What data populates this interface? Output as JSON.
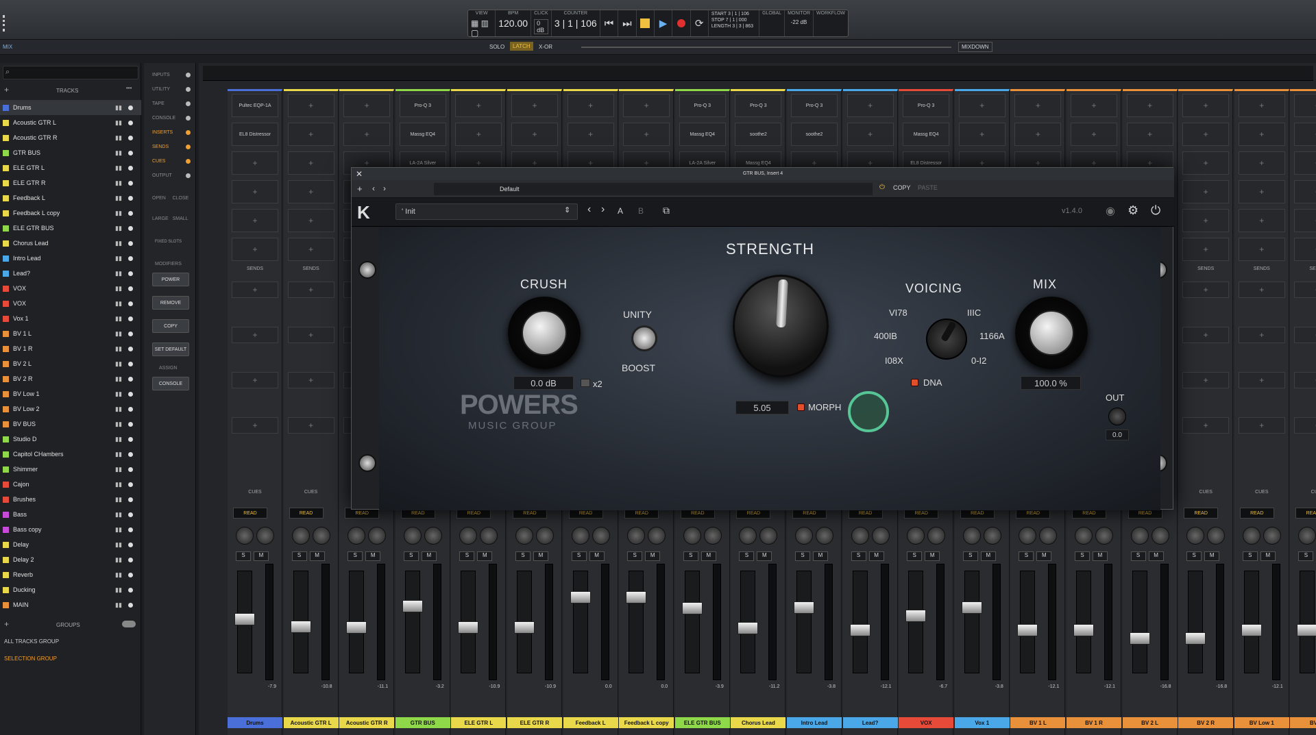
{
  "transport": {
    "view_label": "VIEW",
    "bpm_label": "BPM",
    "bpm": "120.00",
    "click_label": "CLICK",
    "click_db": "0 dB",
    "counter_label": "COUNTER",
    "counter": "3 | 1 | 106",
    "start_label": "START",
    "stop_label": "STOP",
    "length_label": "LENGTH",
    "start_val": "3 | 1 | 106",
    "stop_val": "7 | 1 | 000",
    "length_val": "3 | 3 | 863",
    "global_label": "GLOBAL",
    "monitor_label": "MONITOR",
    "monitor_db": "-22 dB",
    "workflow_label": "WORKFLOW"
  },
  "subbar": {
    "mix_label": "MIX",
    "solo": "SOLO",
    "latch": "LATCH",
    "xor": "X-OR",
    "mixdown": "MIXDOWN"
  },
  "tracks_header": "TRACKS",
  "tracks": [
    {
      "name": "Drums",
      "color": "#4a6fd8"
    },
    {
      "name": "Acoustic GTR L",
      "color": "#e8d84a"
    },
    {
      "name": "Acoustic GTR R",
      "color": "#e8d84a"
    },
    {
      "name": "GTR BUS",
      "color": "#8fd84a"
    },
    {
      "name": "ELE GTR L",
      "color": "#e8d84a"
    },
    {
      "name": "ELE GTR R",
      "color": "#e8d84a"
    },
    {
      "name": "Feedback L",
      "color": "#e8d84a"
    },
    {
      "name": "Feedback L copy",
      "color": "#e8d84a"
    },
    {
      "name": "ELE GTR BUS",
      "color": "#8fd84a"
    },
    {
      "name": "Chorus Lead",
      "color": "#e8d84a"
    },
    {
      "name": "Intro Lead",
      "color": "#4aa8e8"
    },
    {
      "name": "Lead?",
      "color": "#4aa8e8"
    },
    {
      "name": "VOX",
      "color": "#e84a3a"
    },
    {
      "name": "VOX",
      "color": "#e84a3a"
    },
    {
      "name": "Vox 1",
      "color": "#e84a3a"
    },
    {
      "name": "BV 1 L",
      "color": "#e8903a"
    },
    {
      "name": "BV 1 R",
      "color": "#e8903a"
    },
    {
      "name": "BV 2 L",
      "color": "#e8903a"
    },
    {
      "name": "BV 2 R",
      "color": "#e8903a"
    },
    {
      "name": "BV Low 1",
      "color": "#e8903a"
    },
    {
      "name": "BV Low 2",
      "color": "#e8903a"
    },
    {
      "name": "BV BUS",
      "color": "#e8903a"
    },
    {
      "name": "Studio D",
      "color": "#8fd84a"
    },
    {
      "name": "Capitol CHambers",
      "color": "#8fd84a"
    },
    {
      "name": "Shimmer",
      "color": "#8fd84a"
    },
    {
      "name": "Cajon",
      "color": "#e84a3a"
    },
    {
      "name": "Brushes",
      "color": "#e84a3a"
    },
    {
      "name": "Bass",
      "color": "#c84ad8"
    },
    {
      "name": "Bass copy",
      "color": "#c84ad8"
    },
    {
      "name": "Delay",
      "color": "#e8d84a"
    },
    {
      "name": "Delay 2",
      "color": "#e8d84a"
    },
    {
      "name": "Reverb",
      "color": "#e8d84a"
    },
    {
      "name": "Ducking",
      "color": "#e8d84a"
    },
    {
      "name": "MAIN",
      "color": "#e8903a"
    }
  ],
  "groups": {
    "header": "GROUPS",
    "all": "ALL TRACKS GROUP",
    "selection": "SELECTION GROUP"
  },
  "midcol": {
    "items": [
      "INPUTS",
      "UTILITY",
      "TAPE",
      "CONSOLE",
      "INSERTS",
      "SENDS",
      "CUES",
      "OUTPUT"
    ],
    "open": "OPEN",
    "close": "CLOSE",
    "large": "LARGE",
    "small": "SMALL",
    "fixed": "FIXED SLOTS",
    "modifiers": "MODIFIERS",
    "power": "POWER",
    "remove": "REMOVE",
    "copy": "COPY",
    "set_default": "SET DEFAULT",
    "assign": "ASSIGN",
    "console": "CONSOLE"
  },
  "strips": [
    {
      "name": "Drums",
      "color": "#4a6fd8",
      "vol": "-7.9",
      "inserts": [
        "Pultec EQP-1A",
        "EL8 Distressor"
      ]
    },
    {
      "name": "Acoustic GTR L",
      "color": "#e8d84a",
      "vol": "-10.8",
      "inserts": []
    },
    {
      "name": "Acoustic GTR R",
      "color": "#e8d84a",
      "vol": "-11.1",
      "inserts": []
    },
    {
      "name": "GTR BUS",
      "color": "#8fd84a",
      "vol": "-3.2",
      "inserts": [
        "Pro-Q 3",
        "Massg EQ4",
        "LA-2A Silver"
      ]
    },
    {
      "name": "ELE GTR L",
      "color": "#e8d84a",
      "vol": "-10.9",
      "inserts": []
    },
    {
      "name": "ELE GTR R",
      "color": "#e8d84a",
      "vol": "-10.9",
      "inserts": []
    },
    {
      "name": "Feedback L",
      "color": "#e8d84a",
      "vol": "0.0",
      "inserts": []
    },
    {
      "name": "Feedback L copy",
      "color": "#e8d84a",
      "vol": "0.0",
      "inserts": []
    },
    {
      "name": "ELE GTR BUS",
      "color": "#8fd84a",
      "vol": "-3.9",
      "inserts": [
        "Pro-Q 3",
        "Massg EQ4",
        "LA-2A Silver"
      ]
    },
    {
      "name": "Chorus Lead",
      "color": "#e8d84a",
      "vol": "-11.2",
      "inserts": [
        "Pro-Q 3",
        "soothe2",
        "Massg EQ4"
      ]
    },
    {
      "name": "Intro Lead",
      "color": "#4aa8e8",
      "vol": "-3.8",
      "inserts": [
        "Pro-Q 3",
        "soothe2"
      ]
    },
    {
      "name": "Lead?",
      "color": "#4aa8e8",
      "vol": "-12.1",
      "inserts": []
    },
    {
      "name": "VOX",
      "color": "#e84a3a",
      "vol": "-6.7",
      "inserts": [
        "Pro-Q 3",
        "Massg EQ4",
        "EL8 Distressor"
      ]
    },
    {
      "name": "Vox 1",
      "color": "#4aa8e8",
      "vol": "-3.8",
      "inserts": []
    },
    {
      "name": "BV 1 L",
      "color": "#e8903a",
      "vol": "-12.1",
      "inserts": []
    },
    {
      "name": "BV 1 R",
      "color": "#e8903a",
      "vol": "-12.1",
      "inserts": []
    },
    {
      "name": "BV 2 L",
      "color": "#e8903a",
      "vol": "-16.8",
      "inserts": []
    },
    {
      "name": "BV 2 R",
      "color": "#e8903a",
      "vol": "-16.8",
      "inserts": []
    },
    {
      "name": "BV Low 1",
      "color": "#e8903a",
      "vol": "-12.1",
      "inserts": []
    },
    {
      "name": "BV Lo",
      "color": "#e8903a",
      "vol": "-12.1",
      "inserts": []
    }
  ],
  "strip_labels": {
    "read": "READ",
    "sends": "SENDS",
    "cues": "CUES",
    "reverb_send": "Reverb",
    "s": "S",
    "m": "M"
  },
  "plugin_window": {
    "title": "GTR BUS, Insert 4",
    "preset_default": "Default",
    "copy": "COPY",
    "paste": "PASTE",
    "plugin_preset": "' Init",
    "ab_a": "A",
    "ab_b": "B",
    "version": "v1.4.0"
  },
  "plugin": {
    "strength_label": "STRENGTH",
    "strength_val": "5.05",
    "crush_label": "CRUSH",
    "crush_val": "0.0 dB",
    "x2": "x2",
    "unity": "UNITY",
    "boost": "BOOST",
    "voicing_label": "VOICING",
    "voicing_opts": [
      "VI78",
      "IIIC",
      "400IB",
      "1166A",
      "I08X",
      "0-I2"
    ],
    "dna": "DNA",
    "mix_label": "MIX",
    "mix_val": "100.0 %",
    "morph": "MORPH",
    "out_label": "OUT",
    "out_val": "0.0",
    "brand": "POWERS",
    "brand_sub": "MUSIC GROUP"
  }
}
